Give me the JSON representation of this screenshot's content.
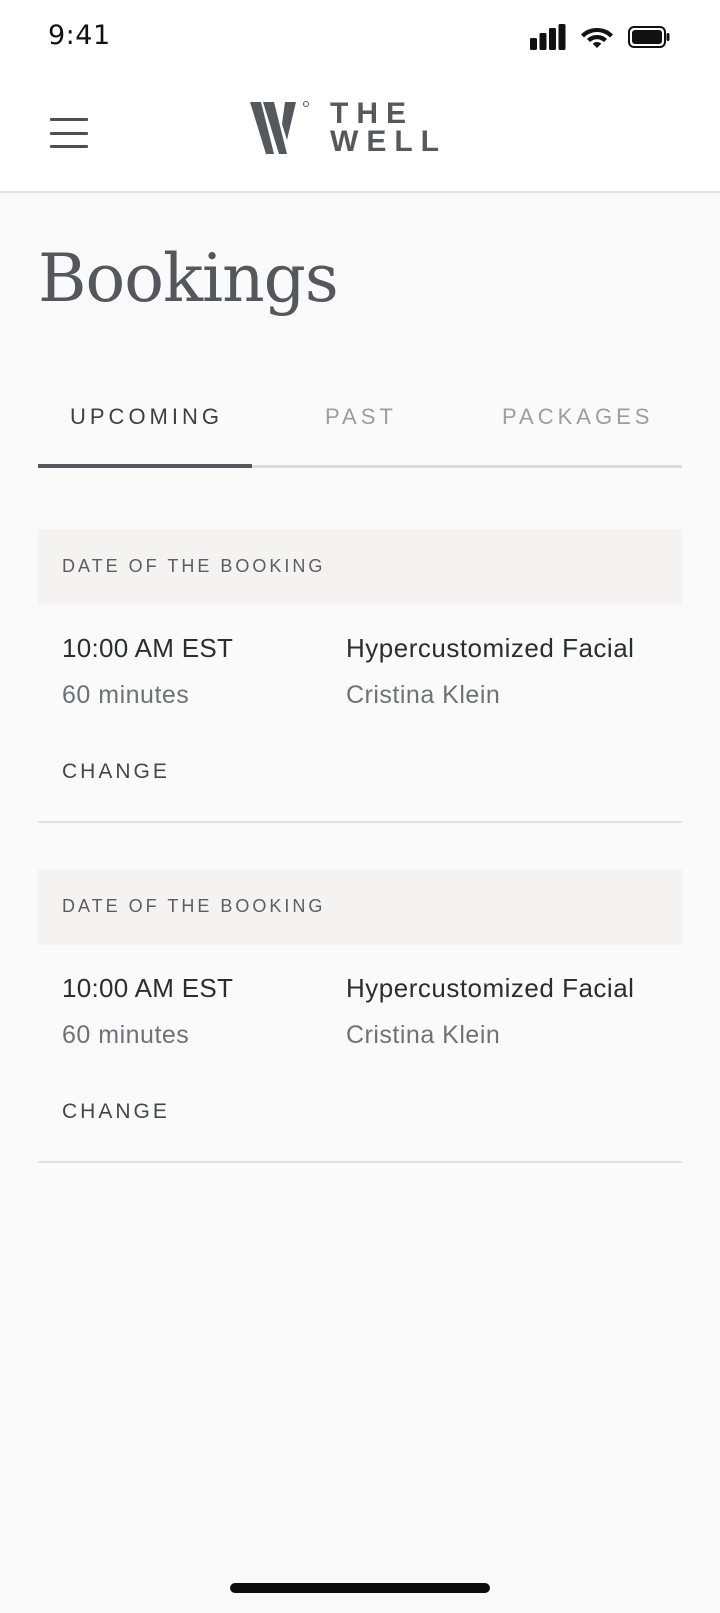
{
  "status_bar": {
    "time": "9:41"
  },
  "header": {
    "brand_line1": "THE",
    "brand_line2": "WELL",
    "menu_icon": "hamburger-icon",
    "logo_icon": "w-monogram-icon"
  },
  "page": {
    "title": "Bookings"
  },
  "tabs": [
    {
      "label": "UPCOMING",
      "active": true
    },
    {
      "label": "PAST",
      "active": false
    },
    {
      "label": "PACKAGES",
      "active": false
    }
  ],
  "bookings": [
    {
      "date_label": "DATE OF THE BOOKING",
      "time": "10:00 AM EST",
      "duration": "60 minutes",
      "service": "Hypercustomized Facial",
      "provider": "Cristina Klein",
      "action_label": "CHANGE"
    },
    {
      "date_label": "DATE OF THE BOOKING",
      "time": "10:00 AM EST",
      "duration": "60 minutes",
      "service": "Hypercustomized Facial",
      "provider": "Cristina Klein",
      "action_label": "CHANGE"
    }
  ],
  "colors": {
    "background": "#fafafa",
    "header_bg": "#ffffff",
    "brand": "#55585d",
    "text_primary": "#2c2d30",
    "text_secondary": "#6f7176",
    "tab_inactive": "#9b9da2",
    "date_strip": "#f4f3f2"
  }
}
